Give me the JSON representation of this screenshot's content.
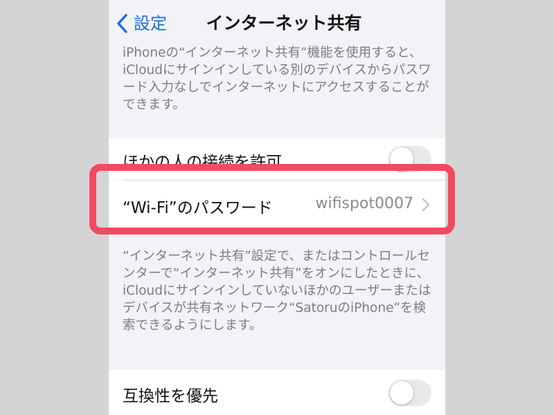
{
  "nav": {
    "back_label": "設定",
    "title": "インターネット共有"
  },
  "notes": {
    "top": "iPhoneの“インターネット共有”機能を使用すると、iCloudにサインインしている別のデバイスからパスワード入力なしでインターネットにアクセスすることができます。",
    "bottom": "“インターネット共有”設定で、またはコントロールセンターで“インターネット共有”をオンにしたときに、iCloudにサインインしていないほかのユーザーまたはデバイスが共有ネットワーク“SatoruのiPhone”を検索できるようにします。"
  },
  "settings": {
    "allow_others": {
      "label": "ほかの人の接続を許可",
      "on": false
    },
    "wifi_password": {
      "label": "“Wi-Fi”のパスワード",
      "value": "wifispot0007"
    },
    "maximize_compat": {
      "label": "互換性を優先",
      "on": false
    }
  },
  "colors": {
    "accent": "#1e6fd9",
    "highlight": "#f04b60",
    "toggle_off": "#e9e9eb"
  },
  "icons": {
    "back": "chevron-left-icon",
    "disclosure": "chevron-right-icon"
  }
}
